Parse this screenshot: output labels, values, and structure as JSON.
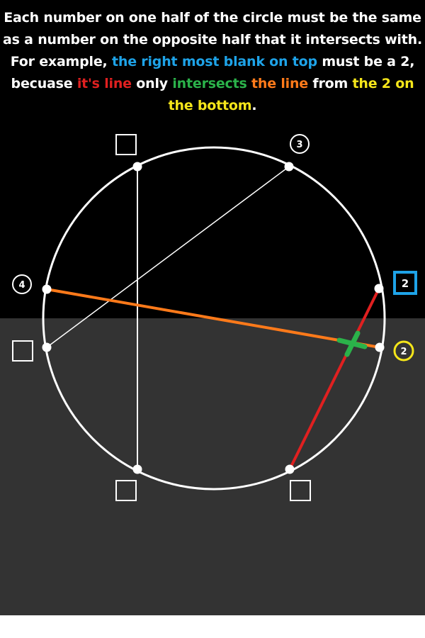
{
  "instructions": {
    "s1": "Each number on one half of the circle must be the same as a number on the opposite half that it intersects with. For example, ",
    "s2": "the right most blank on top",
    "s3": " must be a 2, becuase ",
    "s4": "it's line",
    "s5": " only ",
    "s6": "intersects",
    "s7": " ",
    "s8": "the line",
    "s9": " from ",
    "s10": "the 2 on the bottom",
    "s11": "."
  },
  "puzzle": {
    "top_left_clue": "4",
    "top_right_clue": "3",
    "right_top_box_value": "2",
    "right_bottom_clue": "2",
    "left_bottom_box": "",
    "bottom_left_box": "",
    "bottom_right_box": "",
    "top_left_box": ""
  },
  "colors": {
    "top_background": "#000000",
    "bottom_background": "#333333",
    "blue_highlight": "#1ea3e8",
    "red_line": "#e02020",
    "green_cross": "#2bb24a",
    "orange_line": "#ff7a1a",
    "yellow_circle": "#f5e61a"
  }
}
